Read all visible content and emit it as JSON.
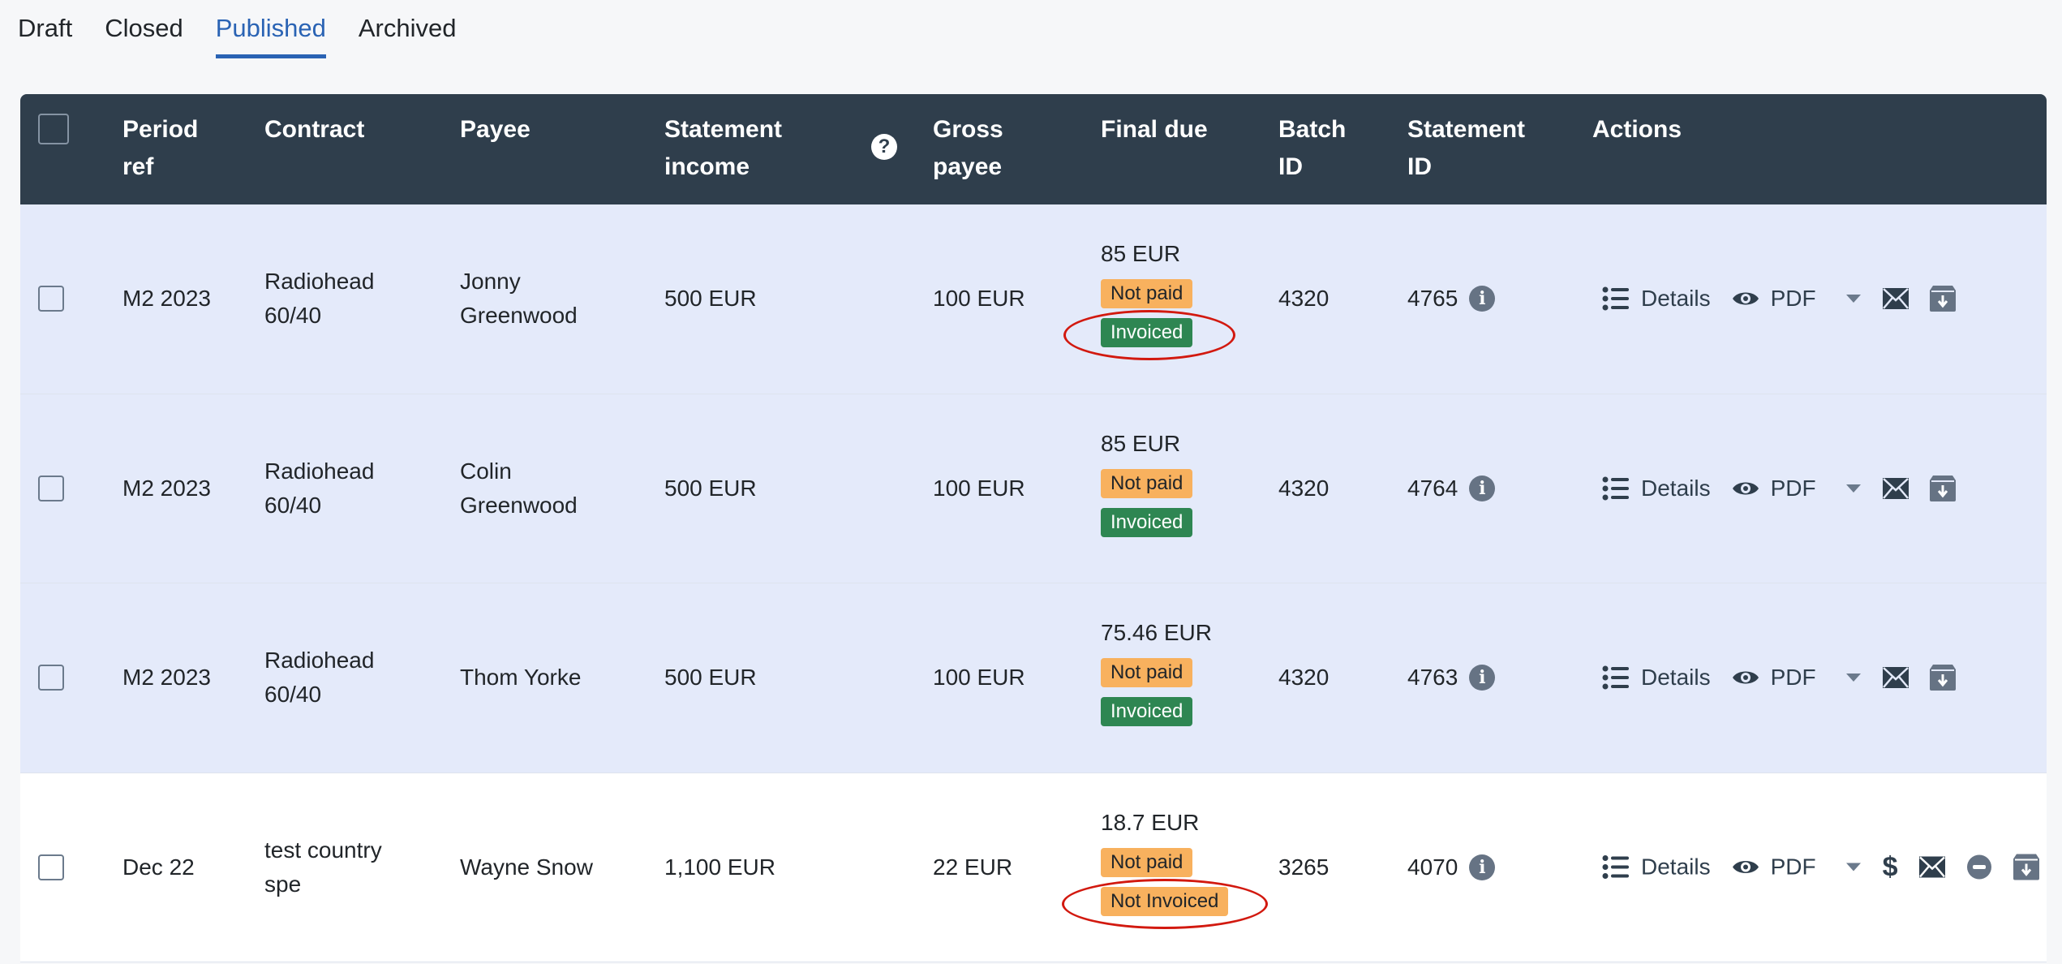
{
  "tabs": [
    {
      "label": "Draft",
      "active": false
    },
    {
      "label": "Closed",
      "active": false
    },
    {
      "label": "Published",
      "active": true
    },
    {
      "label": "Archived",
      "active": false
    }
  ],
  "colors": {
    "accent": "#2a63b4",
    "header_bg": "#2f3e4c",
    "selected_row_bg": "#e4eafa",
    "badge_orange": "#f8b15e",
    "badge_green": "#2e8652",
    "annotation_circle": "#d2190f"
  },
  "table": {
    "headers": {
      "period_ref": [
        "Period",
        "ref"
      ],
      "contract": "Contract",
      "payee": "Payee",
      "statement_income": [
        "Statement",
        "income"
      ],
      "statement_income_help_icon": "question-circle-icon",
      "gross_payee": [
        "Gross",
        "payee"
      ],
      "final_due": "Final due",
      "batch_id": [
        "Batch",
        "ID"
      ],
      "statement_id": [
        "Statement",
        "ID"
      ],
      "actions": "Actions"
    },
    "rows": [
      {
        "period_ref": "M2 2023",
        "contract": [
          "Radiohead",
          "60/40"
        ],
        "payee": [
          "Jonny",
          "Greenwood"
        ],
        "statement_income": "500 EUR",
        "gross_payee": "100 EUR",
        "final_due": "85 EUR",
        "payment_status": "Not paid",
        "invoice_status": "Invoiced",
        "invoice_status_circled": true,
        "batch_id": "4320",
        "statement_id": "4765",
        "selected_style": true
      },
      {
        "period_ref": "M2 2023",
        "contract": [
          "Radiohead",
          "60/40"
        ],
        "payee": [
          "Colin",
          "Greenwood"
        ],
        "statement_income": "500 EUR",
        "gross_payee": "100 EUR",
        "final_due": "85 EUR",
        "payment_status": "Not paid",
        "invoice_status": "Invoiced",
        "invoice_status_circled": false,
        "batch_id": "4320",
        "statement_id": "4764",
        "selected_style": true
      },
      {
        "period_ref": "M2 2023",
        "contract": [
          "Radiohead",
          "60/40"
        ],
        "payee": [
          "Thom Yorke"
        ],
        "statement_income": "500 EUR",
        "gross_payee": "100 EUR",
        "final_due": "75.46 EUR",
        "payment_status": "Not paid",
        "invoice_status": "Invoiced",
        "invoice_status_circled": false,
        "batch_id": "4320",
        "statement_id": "4763",
        "selected_style": true
      },
      {
        "period_ref": "Dec 22",
        "contract": [
          "test country",
          "spe"
        ],
        "payee": [
          "Wayne Snow"
        ],
        "statement_income": "1,100 EUR",
        "gross_payee": "22 EUR",
        "final_due": "18.7 EUR",
        "payment_status": "Not paid",
        "invoice_status": "Not Invoiced",
        "invoice_status_circled": true,
        "batch_id": "3265",
        "statement_id": "4070",
        "selected_style": false
      }
    ],
    "actions": {
      "details_label": "Details",
      "pdf_label": "PDF",
      "icons": [
        "list-icon",
        "eye-icon",
        "caret-down-icon",
        "dollar-icon",
        "envelope-icon",
        "minus-circle-icon",
        "archive-download-icon"
      ]
    }
  }
}
